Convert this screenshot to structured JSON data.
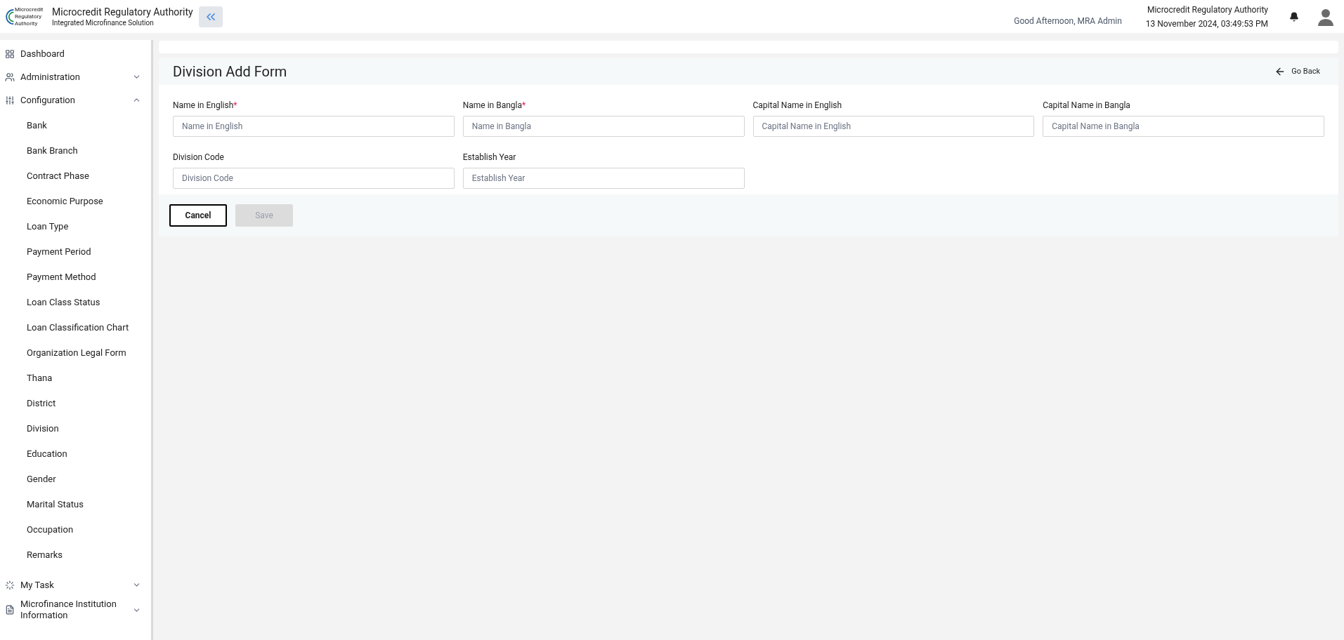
{
  "header": {
    "org_name": "Microcredit Regulatory Authority",
    "subtitle": "Integrated Microfinance Solution",
    "logo_text": [
      "Microcredit",
      "Regulatory",
      "Authority"
    ],
    "greeting": "Good Afternoon, MRA Admin",
    "authority": "Microcredit Regulatory Authority",
    "datetime": "13 November 2024, 03:49:53 PM"
  },
  "sidebar": {
    "items": [
      {
        "label": "Dashboard"
      },
      {
        "label": "Administration",
        "expanded": false
      },
      {
        "label": "Configuration",
        "expanded": true,
        "children": [
          {
            "label": "Bank"
          },
          {
            "label": "Bank Branch"
          },
          {
            "label": "Contract Phase"
          },
          {
            "label": "Economic Purpose"
          },
          {
            "label": "Loan Type"
          },
          {
            "label": "Payment Period"
          },
          {
            "label": "Payment Method"
          },
          {
            "label": "Loan Class Status"
          },
          {
            "label": "Loan Classification Chart"
          },
          {
            "label": "Organization Legal Form"
          },
          {
            "label": "Thana"
          },
          {
            "label": "District"
          },
          {
            "label": "Division"
          },
          {
            "label": "Education"
          },
          {
            "label": "Gender"
          },
          {
            "label": "Marital Status"
          },
          {
            "label": "Occupation"
          },
          {
            "label": "Remarks"
          }
        ]
      },
      {
        "label": "My Task",
        "expanded": false
      },
      {
        "label": "Microfinance Institution Information",
        "expanded": false
      }
    ]
  },
  "form": {
    "title": "Division Add Form",
    "go_back": "Go Back",
    "fields": [
      {
        "label": "Name in English",
        "required_mark": "*",
        "placeholder": "Name in English"
      },
      {
        "label": "Name in Bangla",
        "required_mark": "*",
        "placeholder": "Name in Bangla"
      },
      {
        "label": "Capital Name in English",
        "placeholder": "Capital Name in English"
      },
      {
        "label": "Capital Name in Bangla",
        "placeholder": "Capital Name in Bangla"
      },
      {
        "label": "Division Code",
        "placeholder": "Division Code"
      },
      {
        "label": "Establish Year",
        "placeholder": "Establish Year"
      }
    ],
    "buttons": [
      {
        "label": "Cancel",
        "kind": "outline",
        "disabled": false
      },
      {
        "label": "Save",
        "kind": "primary",
        "disabled": true
      }
    ]
  }
}
